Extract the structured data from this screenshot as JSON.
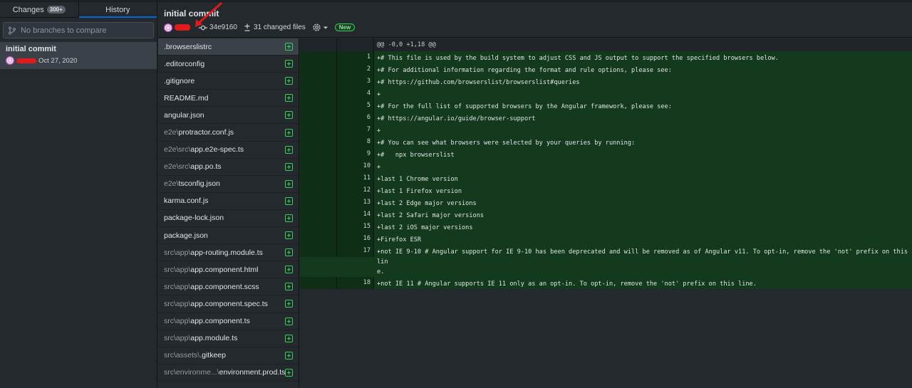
{
  "tabs": {
    "changes_label": "Changes",
    "changes_count": "300+",
    "history_label": "History"
  },
  "branch_compare": {
    "placeholder": "No branches to compare"
  },
  "commit_list": [
    {
      "title": "initial commit",
      "date": "Oct 27, 2020"
    }
  ],
  "header": {
    "title": "initial commit",
    "sha": "34e9160",
    "changed_files": "31 changed files",
    "new_badge": "New"
  },
  "files": [
    {
      "dir": "",
      "name": ".browserslistrc"
    },
    {
      "dir": "",
      "name": ".editorconfig"
    },
    {
      "dir": "",
      "name": ".gitignore"
    },
    {
      "dir": "",
      "name": "README.md"
    },
    {
      "dir": "",
      "name": "angular.json"
    },
    {
      "dir": "e2e\\",
      "name": "protractor.conf.js"
    },
    {
      "dir": "e2e\\src\\",
      "name": "app.e2e-spec.ts"
    },
    {
      "dir": "e2e\\src\\",
      "name": "app.po.ts"
    },
    {
      "dir": "e2e\\",
      "name": "tsconfig.json"
    },
    {
      "dir": "",
      "name": "karma.conf.js"
    },
    {
      "dir": "",
      "name": "package-lock.json"
    },
    {
      "dir": "",
      "name": "package.json"
    },
    {
      "dir": "src\\app\\",
      "name": "app-routing.module.ts"
    },
    {
      "dir": "src\\app\\",
      "name": "app.component.html"
    },
    {
      "dir": "src\\app\\",
      "name": "app.component.scss"
    },
    {
      "dir": "src\\app\\",
      "name": "app.component.spec.ts"
    },
    {
      "dir": "src\\app\\",
      "name": "app.component.ts"
    },
    {
      "dir": "src\\app\\",
      "name": "app.module.ts"
    },
    {
      "dir": "src\\assets\\",
      "name": ".gitkeep"
    },
    {
      "dir": "src\\environme...\\",
      "name": "environment.prod.ts"
    }
  ],
  "diff": {
    "hunk": "@@ -0,0 +1,18 @@",
    "lines": [
      {
        "n": "1",
        "text": "+# This file is used by the build system to adjust CSS and JS output to support the specified browsers below."
      },
      {
        "n": "2",
        "text": "+# For additional information regarding the format and rule options, please see:"
      },
      {
        "n": "3",
        "text": "+# https://github.com/browserslist/browserslist#queries"
      },
      {
        "n": "4",
        "text": "+"
      },
      {
        "n": "5",
        "text": "+# For the full list of supported browsers by the Angular framework, please see:"
      },
      {
        "n": "6",
        "text": "+# https://angular.io/guide/browser-support"
      },
      {
        "n": "7",
        "text": "+"
      },
      {
        "n": "8",
        "text": "+# You can see what browsers were selected by your queries by running:"
      },
      {
        "n": "9",
        "text": "+#   npx browserslist"
      },
      {
        "n": "10",
        "text": "+"
      },
      {
        "n": "11",
        "text": "+last 1 Chrome version"
      },
      {
        "n": "12",
        "text": "+last 1 Firefox version"
      },
      {
        "n": "13",
        "text": "+last 2 Edge major versions"
      },
      {
        "n": "14",
        "text": "+last 2 Safari major versions"
      },
      {
        "n": "15",
        "text": "+last 2 iOS major versions"
      },
      {
        "n": "16",
        "text": "+Firefox ESR"
      },
      {
        "n": "17",
        "text": "+not IE 9-10 # Angular support for IE 9-10 has been deprecated and will be removed as of Angular v11. To opt-in, remove the 'not' prefix on this lin\ne."
      },
      {
        "n": "18",
        "text": "+not IE 11 # Angular supports IE 11 only as an opt-in. To opt-in, remove the 'not' prefix on this line."
      }
    ]
  },
  "icons": {
    "branch": "git-compare-icon",
    "commit": "git-commit-icon",
    "changes": "plus-minus-icon",
    "settings": "gear-icon",
    "added": "file-added-icon"
  },
  "colors": {
    "accent": "#0366d6",
    "added": "#34d058",
    "added_bg": "#133a1c"
  }
}
